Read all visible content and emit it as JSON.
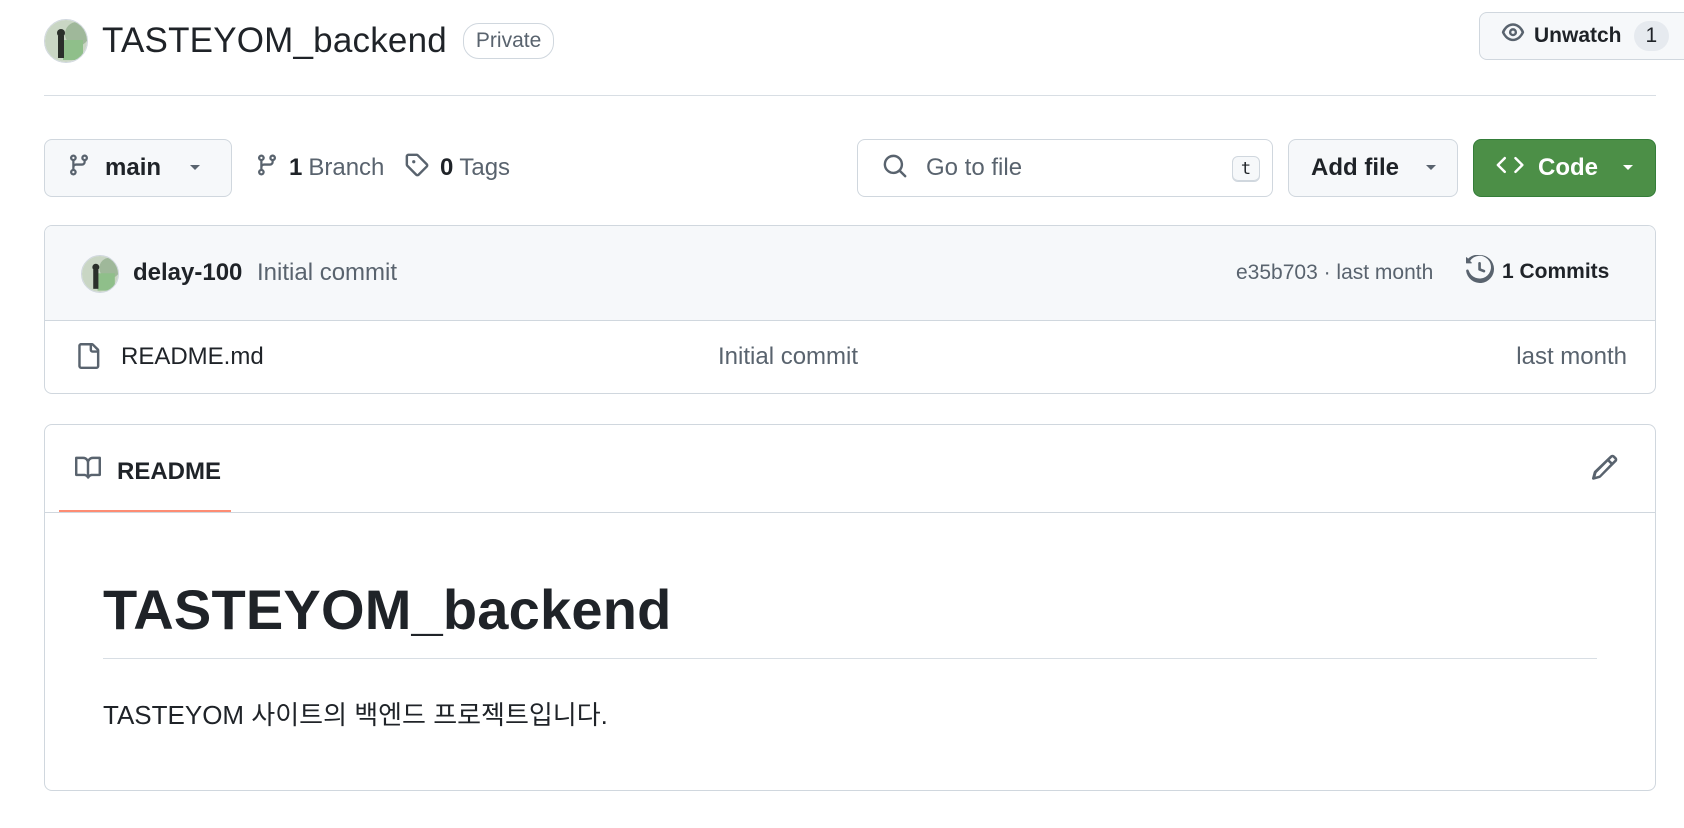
{
  "repo": {
    "name": "TASTEYOM_backend",
    "visibility": "Private",
    "watch": {
      "label": "Unwatch",
      "count": "1"
    }
  },
  "toolbar": {
    "branch": "main",
    "branches": {
      "count": "1",
      "label": "Branch"
    },
    "tags": {
      "count": "0",
      "label": "Tags"
    },
    "search": {
      "placeholder": "Go to file",
      "shortcut": "t"
    },
    "add_file": "Add file",
    "code": "Code"
  },
  "latest_commit": {
    "author": "delay-100",
    "message": "Initial commit",
    "hash_time": "e35b703 · last month",
    "commits": "1 Commits"
  },
  "files": [
    {
      "name": "README.md",
      "commit": "Initial commit",
      "time": "last month"
    }
  ],
  "readme": {
    "tab": "README",
    "heading": "TASTEYOM_backend",
    "body": "TASTEYOM 사이트의 백엔드 프로젝트입니다."
  },
  "colors": {
    "code_button": "#4c8f47",
    "readme_tab_underline": "#fd8c73",
    "muted_text": "#59636e",
    "border": "#d0d7de"
  },
  "icons": [
    "eye-icon",
    "git-branch-icon",
    "tag-icon",
    "search-icon",
    "code-icon",
    "history-icon",
    "file-icon",
    "book-icon",
    "pencil-icon",
    "triangle-down-icon"
  ]
}
